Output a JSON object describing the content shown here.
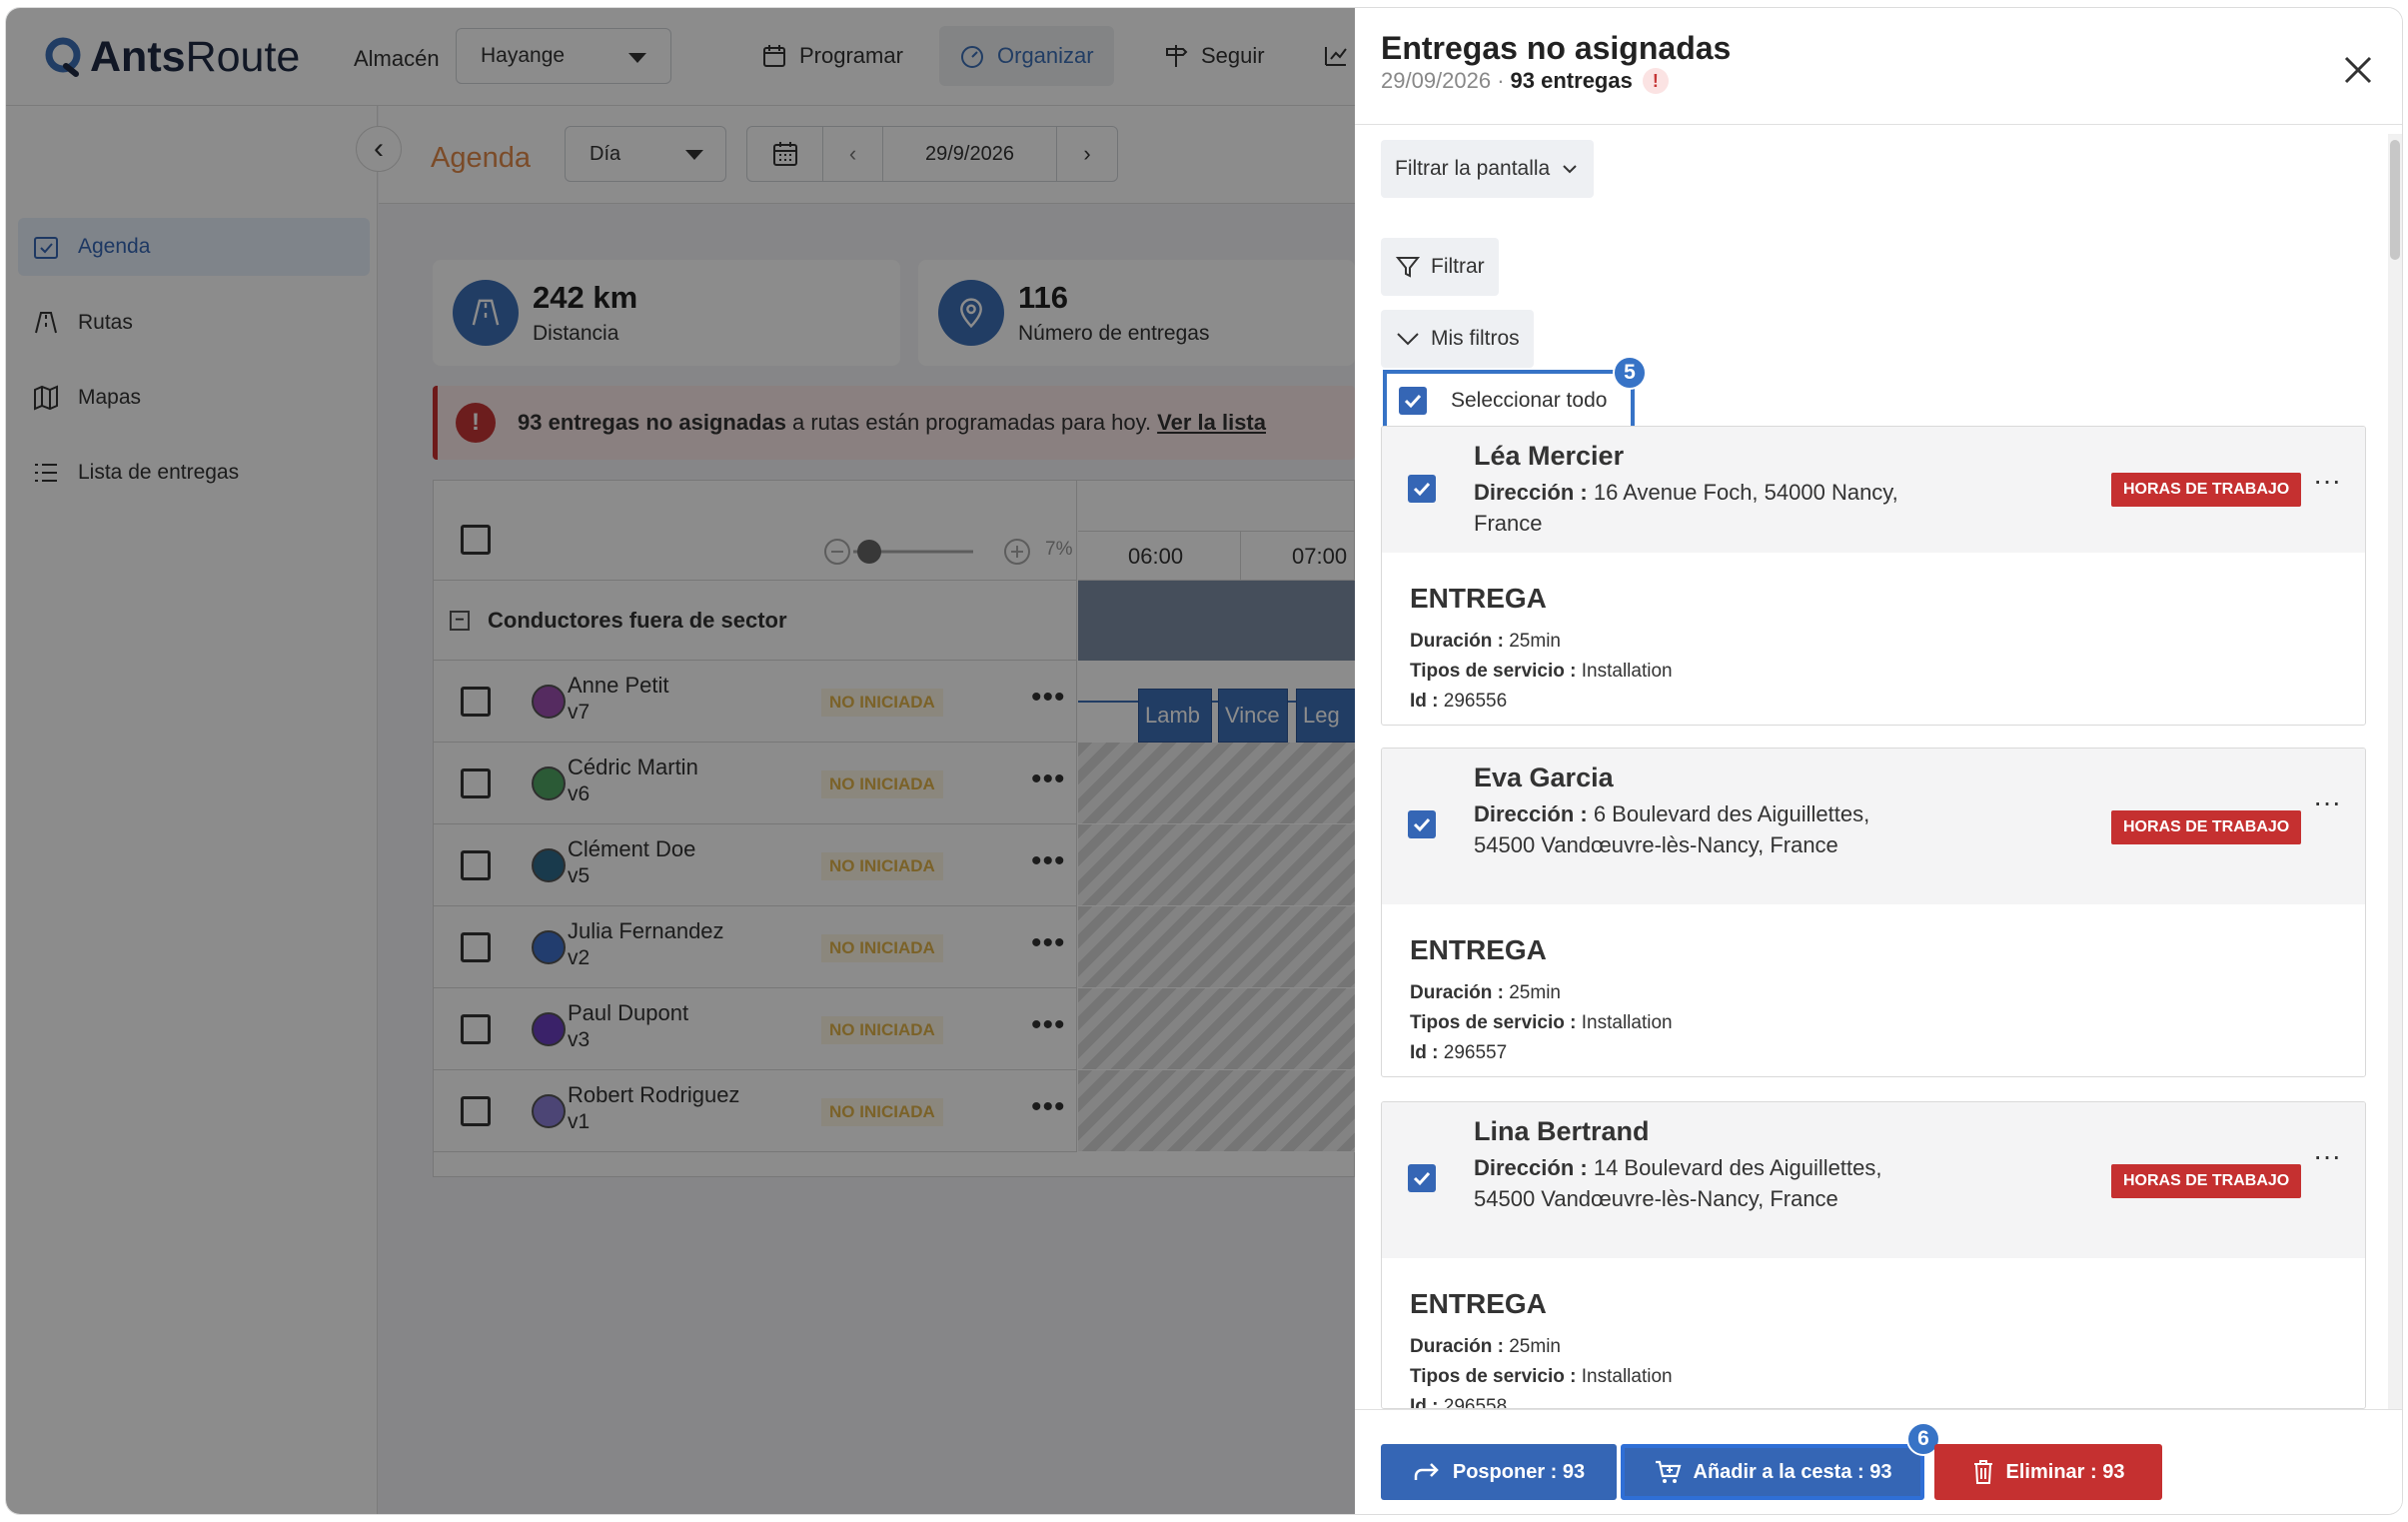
{
  "header": {
    "logo_bold": "Ants",
    "logo_light": "Route",
    "warehouse_label": "Almacén",
    "warehouse_value": "Hayange",
    "nav": [
      {
        "label": "Programar",
        "icon": "calendar-icon"
      },
      {
        "label": "Organizar",
        "icon": "gauge-icon",
        "active": true
      },
      {
        "label": "Seguir",
        "icon": "signpost-icon"
      }
    ]
  },
  "sidebar": {
    "items": [
      {
        "label": "Agenda",
        "icon": "calendar-check-icon",
        "active": true
      },
      {
        "label": "Rutas",
        "icon": "road-icon"
      },
      {
        "label": "Mapas",
        "icon": "map-icon"
      },
      {
        "label": "Lista de entregas",
        "icon": "list-icon"
      }
    ]
  },
  "agenda": {
    "title": "Agenda",
    "view": "Día",
    "date": "29/9/2026",
    "stats": [
      {
        "value": "242 km",
        "label": "Distancia",
        "icon": "road-icon"
      },
      {
        "value": "116",
        "label": "Número de entregas",
        "icon": "map-pin-icon"
      }
    ],
    "alert": {
      "bold": "93 entregas no asignadas",
      "text": "a rutas están programadas para hoy.",
      "link": "Ver la lista"
    },
    "zoom_pct": "7%",
    "hours": [
      "06:00",
      "07:00"
    ],
    "group_label": "Conductores fuera de sector",
    "drivers": [
      {
        "name": "Anne Petit",
        "vehicle": "v7",
        "status": "NO INICIADA",
        "color": "#9b4fb0"
      },
      {
        "name": "Cédric Martin",
        "vehicle": "v6",
        "status": "NO INICIADA",
        "color": "#4fa463"
      },
      {
        "name": "Clément Doe",
        "vehicle": "v5",
        "status": "NO INICIADA",
        "color": "#2f6b8a"
      },
      {
        "name": "Julia Fernandez",
        "vehicle": "v2",
        "status": "NO INICIADA",
        "color": "#3f6fc8"
      },
      {
        "name": "Paul Dupont",
        "vehicle": "v3",
        "status": "NO INICIADA",
        "color": "#6a3fc0"
      },
      {
        "name": "Robert Rodriguez",
        "vehicle": "v1",
        "status": "NO INICIADA",
        "color": "#8a7fd6"
      }
    ],
    "tasks": [
      "Lamb",
      "Vince",
      "Leg"
    ]
  },
  "panel": {
    "title": "Entregas no asignadas",
    "date": "29/09/2026 ·",
    "count": "93 entregas",
    "filter_screen": "Filtrar la pantalla",
    "filter": "Filtrar",
    "my_filters": "Mis filtros",
    "select_all": "Seleccionar todo",
    "step_select_all": "5",
    "step_basket": "6",
    "labels": {
      "address": "Dirección :",
      "duration": "Duración :",
      "service": "Tipos de servicio :",
      "id": "Id :"
    },
    "deliveries": [
      {
        "name": "Léa Mercier",
        "address": "16 Avenue Foch, 54000 Nancy, France",
        "tag": "HORAS DE TRABAJO",
        "kind": "ENTREGA",
        "duration": "25min",
        "service": "Installation",
        "id": "296556"
      },
      {
        "name": "Eva Garcia",
        "address": "6 Boulevard des Aiguillettes, 54500 Vandœuvre-lès-Nancy, France",
        "tag": "HORAS DE TRABAJO",
        "kind": "ENTREGA",
        "duration": "25min",
        "service": "Installation",
        "id": "296557"
      },
      {
        "name": "Lina Bertrand",
        "address": "14 Boulevard des Aiguillettes, 54500 Vandœuvre-lès-Nancy, France",
        "tag": "HORAS DE TRABAJO",
        "kind": "ENTREGA",
        "duration": "25min",
        "service": "Installation",
        "id": "296558"
      }
    ],
    "actions": {
      "postpone": "Posponer : 93",
      "basket": "Añadir a la cesta : 93",
      "delete": "Eliminar : 93"
    }
  },
  "colors": {
    "primary": "#3566b5",
    "danger": "#c53030",
    "accent": "#e0894a"
  }
}
